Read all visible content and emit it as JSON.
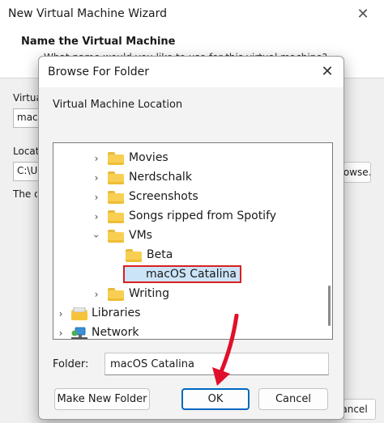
{
  "wizard": {
    "title": "New Virtual Machine Wizard",
    "heading": "Name the Virtual Machine",
    "subheading": "What name would you like to use for this virtual machine?",
    "name_label": "Virtual machine name:",
    "name_value": "macOS Catalina",
    "location_label": "Location:",
    "location_value": "C:\\Users",
    "browse_label": "Browse...",
    "note": "The default location can be changed at Edit > Preferences.",
    "cancel_label": "Cancel"
  },
  "dialog": {
    "title": "Browse For Folder",
    "description": "Virtual Machine Location",
    "tree": [
      {
        "label": "Movies",
        "level": 2,
        "expanded": false,
        "icon": "folder-icon"
      },
      {
        "label": "Nerdschalk",
        "level": 2,
        "expanded": false,
        "icon": "folder-icon"
      },
      {
        "label": "Screenshots",
        "level": 2,
        "expanded": false,
        "icon": "folder-icon"
      },
      {
        "label": "Songs ripped from Spotify",
        "level": 2,
        "expanded": false,
        "icon": "folder-icon"
      },
      {
        "label": "VMs",
        "level": 2,
        "expanded": true,
        "icon": "folder-icon"
      },
      {
        "label": "Beta",
        "level": 3,
        "expanded": null,
        "icon": "folder-icon"
      },
      {
        "label": "macOS Catalina",
        "level": 3,
        "expanded": null,
        "icon": "folder-icon",
        "selected": true
      },
      {
        "label": "Writing",
        "level": 2,
        "expanded": false,
        "icon": "folder-icon"
      },
      {
        "label": "Libraries",
        "level": 0,
        "expanded": false,
        "icon": "library-icon"
      },
      {
        "label": "Network",
        "level": 0,
        "expanded": false,
        "icon": "network-icon"
      }
    ],
    "folder_label": "Folder:",
    "folder_value": "macOS Catalina",
    "make_new_folder_label": "Make New Folder",
    "ok_label": "OK",
    "cancel_label": "Cancel"
  },
  "colors": {
    "selection_bg": "#cce4f7",
    "highlight_border": "#d92020",
    "annotation_arrow": "#e0102a",
    "accent": "#0067c0",
    "folder_yellow": "#f8cf52"
  }
}
